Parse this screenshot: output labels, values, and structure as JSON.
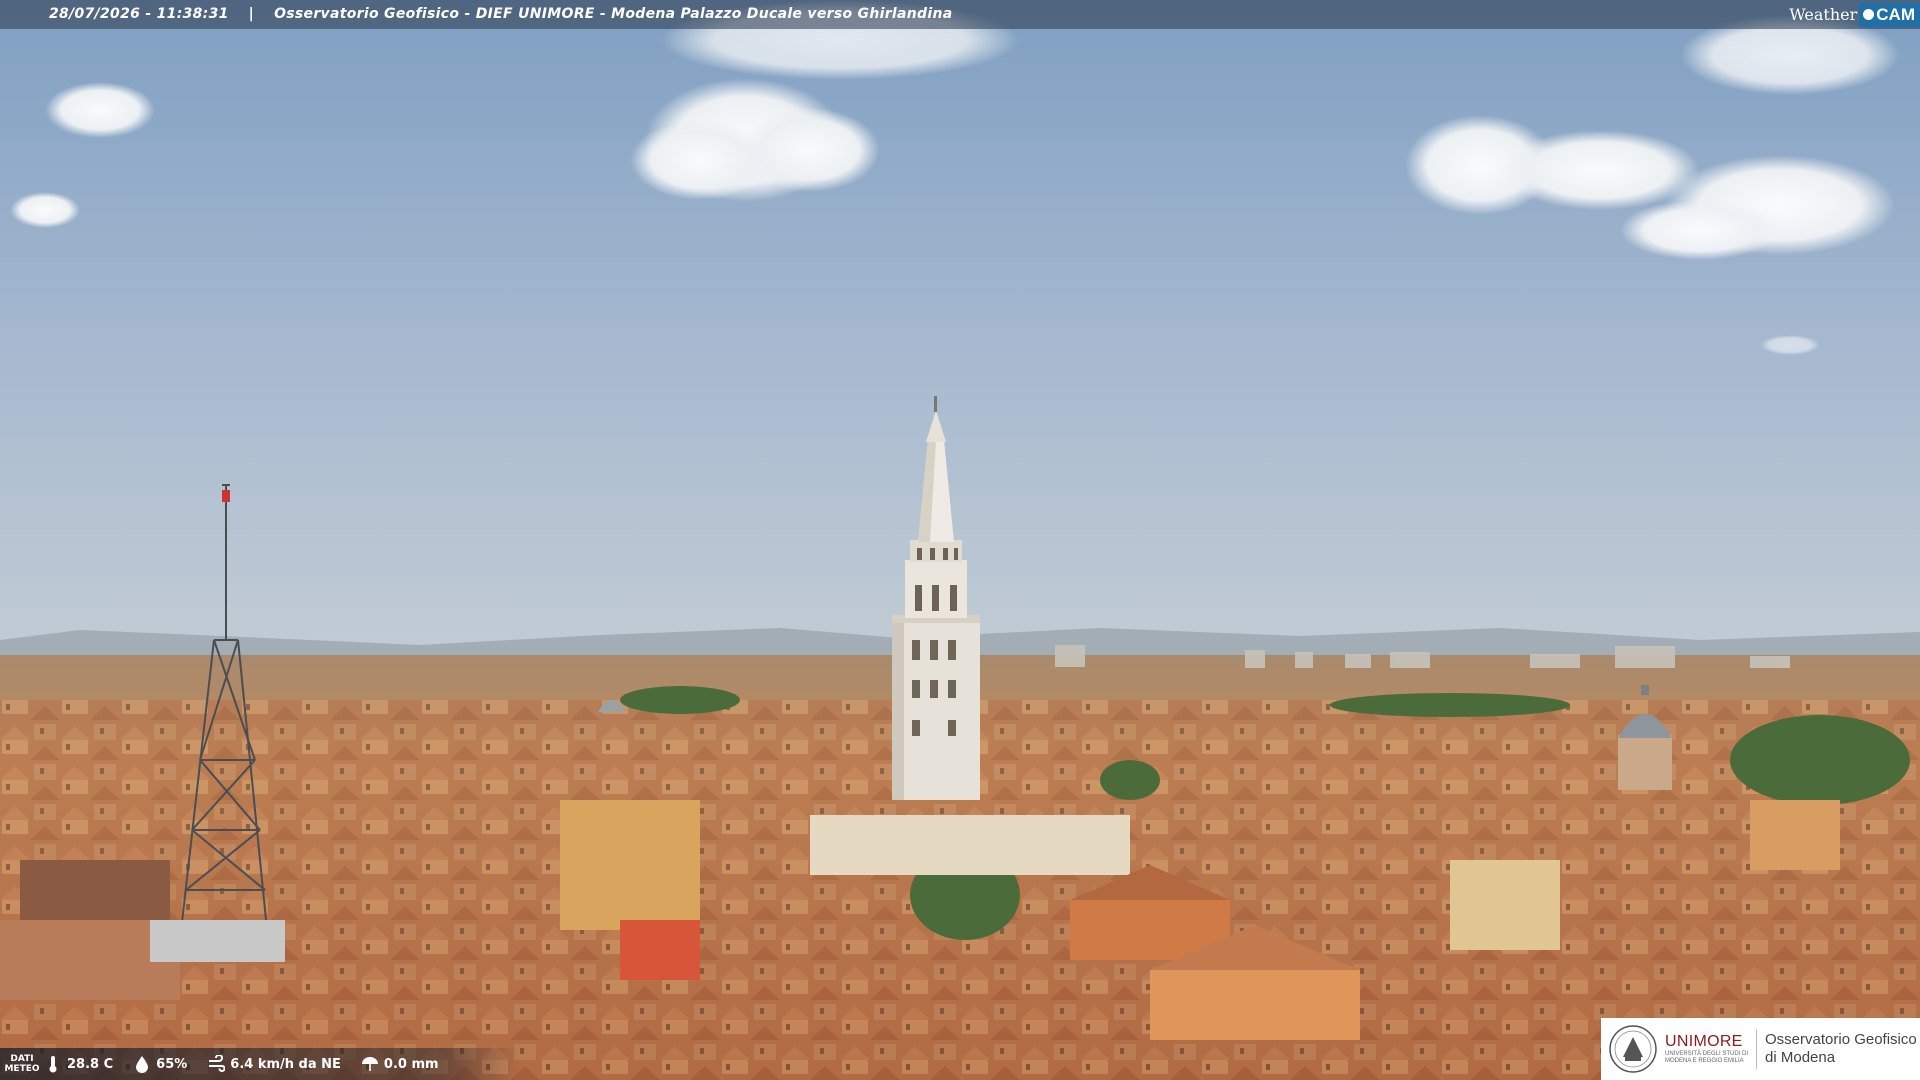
{
  "header": {
    "timestamp": "28/07/2026 - 11:38:31",
    "separator": "|",
    "title": "Osservatorio Geofisico - DIEF UNIMORE - Modena Palazzo Ducale verso Ghirlandina"
  },
  "brand": {
    "weather": "Weather",
    "cam": "CAM"
  },
  "meteo": {
    "label_line1": "DATI",
    "label_line2": "METEO",
    "temperature": "28.8 C",
    "humidity": "65%",
    "wind": "6.4 km/h da NE",
    "rain": "0.0 mm",
    "icons": [
      "thermometer-icon",
      "humidity-icon",
      "wind-icon",
      "rain-icon"
    ]
  },
  "logo": {
    "university": "UNIMORE",
    "university_sub1": "UNIVERSITÀ DEGLI STUDI DI",
    "university_sub2": "MODENA E REGGIO EMILIA",
    "observatory_line1": "Osservatorio Geofisico",
    "observatory_line2": "di Modena"
  },
  "colors": {
    "sky_top": "#7f9fc2",
    "sky_horizon": "#b9c7d3",
    "roofs": "#b86c44",
    "facades": "#d9a16a",
    "tower": "#e8e3da",
    "brand_blue": "#1f6fa8",
    "unimore_red": "#8c1b1b"
  }
}
